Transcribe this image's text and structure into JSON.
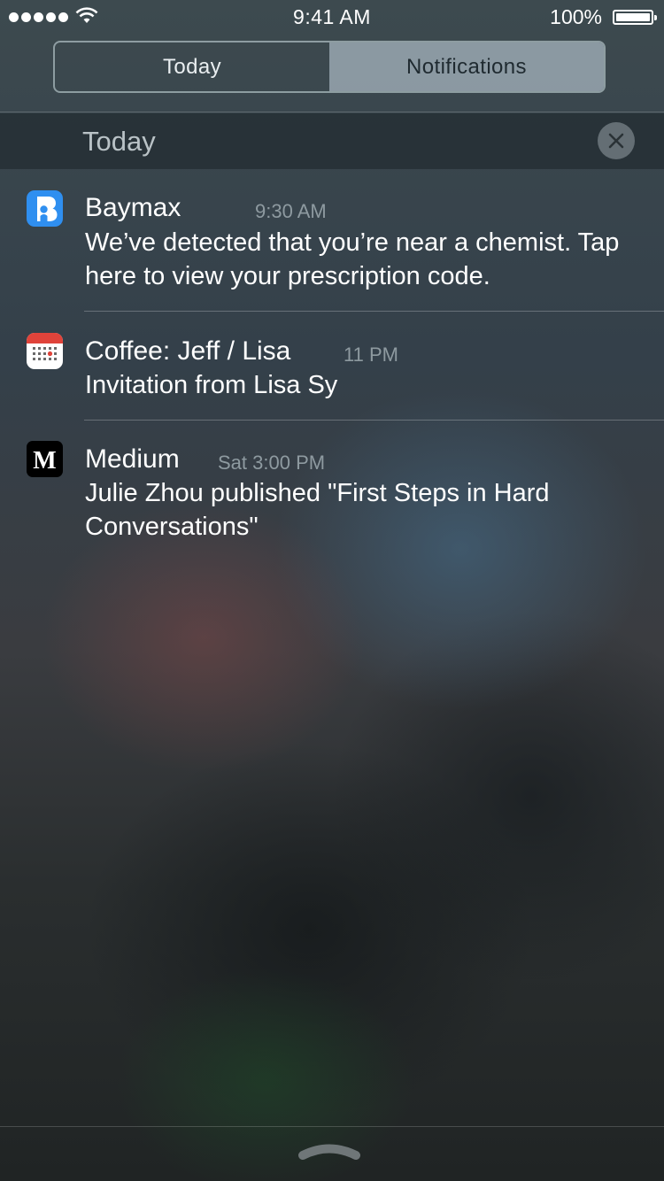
{
  "status_bar": {
    "time": "9:41 AM",
    "battery_percent": "100%",
    "signal_dots": 5,
    "icons": [
      "signal-dots-icon",
      "wifi-icon",
      "battery-icon"
    ]
  },
  "tabs": [
    {
      "label": "Today",
      "selected": false
    },
    {
      "label": "Notifications",
      "selected": true
    }
  ],
  "section": {
    "title": "Today",
    "clear_icon": "close-icon"
  },
  "notifications": [
    {
      "app": "Baymax",
      "time": "9:30 AM",
      "body": "We’ve detected that you’re near a chemist. Tap here to view your prescription code.",
      "icon": "baymax-app-icon"
    },
    {
      "app": "Coffee: Jeff / Lisa",
      "time": "11 PM",
      "body": "Invitation from Lisa Sy",
      "icon": "calendar-app-icon"
    },
    {
      "app": "Medium",
      "time": "Sat 3:00 PM",
      "body": "Julie Zhou published \"First Steps in Hard Conversations\"",
      "icon": "medium-app-icon"
    }
  ],
  "colors": {
    "segment_selected": "#aab9c3",
    "baymax_blue": "#2f8ff0",
    "calendar_red": "#e0433a",
    "secondary_text": "#8e9aa0"
  },
  "bottom": {
    "grabber_icon": "chevron-up-grabber-icon"
  }
}
